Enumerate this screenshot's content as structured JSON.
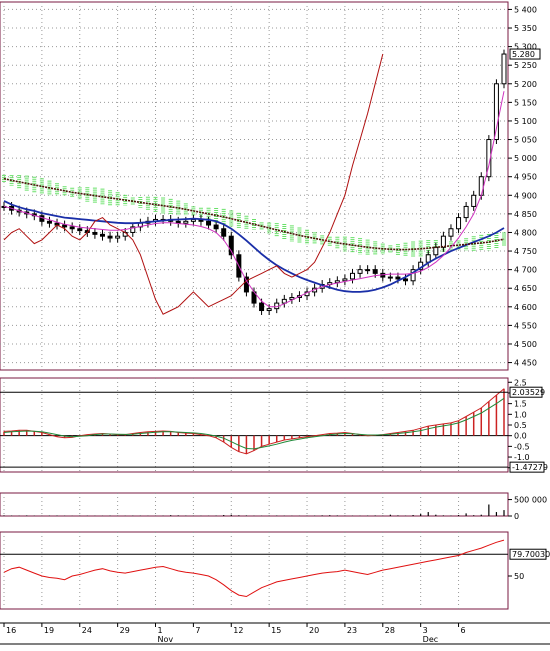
{
  "chart_data": [
    {
      "panel": "price",
      "type": "line",
      "y_ticks": [
        "5 400",
        "5 350",
        "5 300",
        "5 250",
        "5 200",
        "5 150",
        "5 100",
        "5 050",
        "5 000",
        "4 950",
        "4 900",
        "4 850",
        "4 800",
        "4 750",
        "4 700",
        "4 650",
        "4 600",
        "4 550",
        "4 500",
        "4 450"
      ],
      "ylim": [
        4430,
        5420
      ],
      "last_value_label": "5.280",
      "last_value": 5280,
      "series": [
        {
          "key": "price",
          "color": "#000000",
          "values": [
            4870,
            4860,
            4855,
            4850,
            4845,
            4830,
            4825,
            4820,
            4815,
            4810,
            4805,
            4800,
            4795,
            4790,
            4785,
            4790,
            4800,
            4815,
            4825,
            4830,
            4835,
            4835,
            4830,
            4825,
            4830,
            4835,
            4830,
            4820,
            4810,
            4790,
            4740,
            4680,
            4640,
            4610,
            4590,
            4595,
            4610,
            4620,
            4625,
            4630,
            4640,
            4650,
            4660,
            4665,
            4670,
            4675,
            4690,
            4700,
            4700,
            4690,
            4680,
            4680,
            4675,
            4670,
            4700,
            4720,
            4740,
            4760,
            4790,
            4810,
            4840,
            4870,
            4900,
            4950,
            5050,
            5200,
            5280
          ]
        },
        {
          "key": "ma_blue",
          "color": "#1a2fa8",
          "values": [
            4885,
            4875,
            4868,
            4862,
            4858,
            4852,
            4848,
            4844,
            4840,
            4838,
            4836,
            4834,
            4832,
            4830,
            4828,
            4826,
            4825,
            4825,
            4826,
            4828,
            4830,
            4832,
            4834,
            4835,
            4836,
            4837,
            4836,
            4834,
            4830,
            4822,
            4810,
            4795,
            4778,
            4760,
            4742,
            4726,
            4712,
            4700,
            4690,
            4680,
            4672,
            4665,
            4658,
            4652,
            4646,
            4642,
            4640,
            4640,
            4642,
            4646,
            4652,
            4660,
            4670,
            4680,
            4692,
            4705,
            4718,
            4730,
            4740,
            4750,
            4758,
            4766,
            4774,
            4782,
            4790,
            4800,
            4812
          ]
        },
        {
          "key": "ma_brown",
          "color": "#4b1208",
          "values": [
            4945,
            4940,
            4936,
            4932,
            4928,
            4924,
            4920,
            4916,
            4912,
            4908,
            4905,
            4902,
            4899,
            4896,
            4893,
            4890,
            4887,
            4884,
            4881,
            4878,
            4875,
            4872,
            4869,
            4866,
            4862,
            4858,
            4854,
            4850,
            4846,
            4842,
            4837,
            4832,
            4827,
            4822,
            4817,
            4812,
            4807,
            4802,
            4797,
            4792,
            4788,
            4784,
            4780,
            4776,
            4772,
            4769,
            4766,
            4763,
            4760,
            4758,
            4756,
            4755,
            4754,
            4754,
            4755,
            4756,
            4758,
            4760,
            4762,
            4764,
            4766,
            4768,
            4770,
            4772,
            4774,
            4778,
            4782
          ]
        },
        {
          "key": "lag_red",
          "color": "#b01010",
          "values": [
            4780,
            4800,
            4810,
            4790,
            4770,
            4780,
            4800,
            4820,
            4810,
            4790,
            4780,
            4800,
            4830,
            4840,
            4820,
            4810,
            4800,
            4780,
            4740,
            4680,
            4620,
            4580,
            4590,
            4600,
            4620,
            4640,
            4620,
            4600,
            4610,
            4620,
            4630,
            4650,
            4670,
            4680,
            4690,
            4700,
            4710,
            4690,
            4680,
            4690,
            4700,
            4720,
            4760,
            4800,
            4850,
            4900,
            4980,
            5050,
            5120,
            5200,
            5280,
            null,
            null,
            null,
            null,
            null,
            null,
            null,
            null,
            null,
            null,
            null,
            null,
            null,
            null,
            null,
            null
          ]
        },
        {
          "key": "env_magenta",
          "color": "#d030c0",
          "values": [
            4870,
            4865,
            4858,
            4852,
            4846,
            4840,
            4834,
            4828,
            4822,
            4818,
            4814,
            4812,
            4810,
            4808,
            4806,
            4806,
            4808,
            4812,
            4816,
            4820,
            4824,
            4826,
            4826,
            4824,
            4822,
            4820,
            4816,
            4810,
            4800,
            4780,
            4750,
            4710,
            4670,
            4640,
            4615,
            4600,
            4600,
            4608,
            4618,
            4628,
            4638,
            4646,
            4654,
            4660,
            4664,
            4668,
            4672,
            4676,
            4680,
            4684,
            4686,
            4688,
            4688,
            4688,
            4690,
            4696,
            4706,
            4720,
            4738,
            4760,
            4785,
            4815,
            4850,
            4900,
            4980,
            5080,
            5180
          ]
        }
      ]
    },
    {
      "panel": "macd",
      "type": "bar",
      "y_ticks": [
        "2.5",
        "2.0",
        "1.5",
        "1.0",
        "0.5",
        "0.0",
        "-0.5",
        "-1.0",
        "-1.5"
      ],
      "ylim": [
        -1.7,
        2.7
      ],
      "upper_label": "2.03529",
      "lower_label": "-1.47279",
      "values": [
        0.2,
        0.22,
        0.25,
        0.25,
        0.2,
        0.15,
        0.05,
        -0.05,
        -0.1,
        -0.08,
        0.0,
        0.05,
        0.08,
        0.1,
        0.08,
        0.05,
        0.05,
        0.1,
        0.15,
        0.18,
        0.2,
        0.22,
        0.2,
        0.15,
        0.12,
        0.1,
        0.05,
        0.0,
        -0.1,
        -0.3,
        -0.55,
        -0.75,
        -0.85,
        -0.7,
        -0.5,
        -0.4,
        -0.3,
        -0.2,
        -0.15,
        -0.1,
        -0.05,
        0.0,
        0.05,
        0.1,
        0.12,
        0.15,
        0.1,
        0.05,
        0.0,
        0.02,
        0.05,
        0.1,
        0.15,
        0.2,
        0.25,
        0.35,
        0.45,
        0.5,
        0.55,
        0.6,
        0.7,
        0.9,
        1.1,
        1.3,
        1.6,
        1.9,
        2.2
      ],
      "signal": [
        0.15,
        0.18,
        0.2,
        0.22,
        0.21,
        0.18,
        0.12,
        0.05,
        -0.02,
        -0.05,
        -0.03,
        0.0,
        0.05,
        0.08,
        0.08,
        0.07,
        0.06,
        0.07,
        0.1,
        0.13,
        0.16,
        0.18,
        0.19,
        0.17,
        0.15,
        0.13,
        0.1,
        0.05,
        -0.02,
        -0.12,
        -0.28,
        -0.45,
        -0.6,
        -0.62,
        -0.55,
        -0.48,
        -0.4,
        -0.3,
        -0.22,
        -0.16,
        -0.1,
        -0.05,
        0.0,
        0.05,
        0.08,
        0.1,
        0.09,
        0.06,
        0.03,
        0.03,
        0.04,
        0.07,
        0.1,
        0.14,
        0.18,
        0.24,
        0.32,
        0.4,
        0.46,
        0.52,
        0.6,
        0.74,
        0.9,
        1.06,
        1.28,
        1.5,
        1.75
      ]
    },
    {
      "panel": "volume",
      "type": "bar",
      "y_ticks": [
        "500 000",
        "0"
      ],
      "ylim": [
        0,
        700000
      ],
      "values": [
        20000,
        15000,
        10000,
        18000,
        12000,
        9000,
        14000,
        16000,
        11000,
        8000,
        13000,
        12000,
        10000,
        9000,
        15000,
        11000,
        10000,
        14000,
        12000,
        9000,
        10000,
        12000,
        25000,
        20000,
        14000,
        12000,
        10000,
        9000,
        15000,
        30000,
        40000,
        22000,
        18000,
        12000,
        10000,
        14000,
        16000,
        12000,
        10000,
        9000,
        12000,
        15000,
        20000,
        25000,
        18000,
        14000,
        12000,
        10000,
        15000,
        18000,
        14000,
        40000,
        20000,
        12000,
        30000,
        60000,
        120000,
        40000,
        20000,
        15000,
        30000,
        80000,
        25000,
        40000,
        350000,
        120000,
        180000
      ]
    },
    {
      "panel": "rsi",
      "type": "line",
      "y_ticks": [
        "50"
      ],
      "ylim": [
        5,
        110
      ],
      "upper_label": "79.70030",
      "values": [
        55,
        60,
        62,
        58,
        54,
        50,
        48,
        47,
        45,
        50,
        52,
        55,
        58,
        60,
        57,
        55,
        54,
        56,
        58,
        60,
        62,
        63,
        60,
        57,
        55,
        54,
        52,
        50,
        45,
        38,
        30,
        24,
        22,
        28,
        34,
        38,
        42,
        44,
        46,
        48,
        50,
        52,
        54,
        55,
        56,
        58,
        56,
        54,
        52,
        55,
        58,
        60,
        62,
        64,
        66,
        68,
        70,
        72,
        74,
        76,
        78,
        82,
        85,
        88,
        92,
        96,
        99
      ]
    }
  ],
  "x_axis": {
    "labels": [
      {
        "text": "16",
        "i": 0
      },
      {
        "text": "19",
        "i": 5
      },
      {
        "text": "24",
        "i": 10
      },
      {
        "text": "29",
        "i": 15
      },
      {
        "text": "1",
        "i": 20,
        "month": "Nov"
      },
      {
        "text": "7",
        "i": 25
      },
      {
        "text": "12",
        "i": 30
      },
      {
        "text": "15",
        "i": 35
      },
      {
        "text": "20",
        "i": 40
      },
      {
        "text": "23",
        "i": 45
      },
      {
        "text": "28",
        "i": 50
      },
      {
        "text": "3",
        "i": 55,
        "month": "Dec"
      },
      {
        "text": "6",
        "i": 60
      }
    ]
  },
  "colors": {
    "price": "#000000",
    "ma_blue": "#1a2fa8",
    "ma_brown": "#4b1208",
    "lag_red": "#b01010",
    "env_magenta": "#d030c0",
    "cloud": "#36d836",
    "macd_bar": "#cc2222",
    "signal_green": "#1f8a3a",
    "rsi": "#e01010",
    "grid": "#9a9a9a",
    "border": "#7a1a40"
  }
}
